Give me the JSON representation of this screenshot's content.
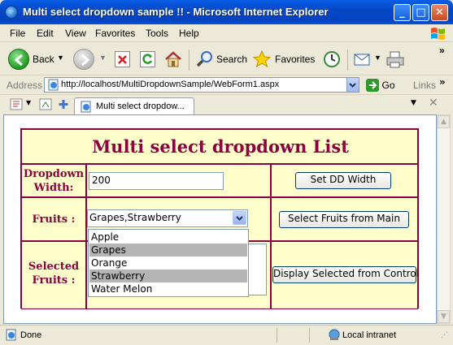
{
  "window": {
    "title": "Multi select dropdown sample !! - Microsoft Internet Explorer",
    "minimize": "_",
    "maximize": "□",
    "close": "✕"
  },
  "menu": [
    "File",
    "Edit",
    "View",
    "Favorites",
    "Tools",
    "Help"
  ],
  "toolbar": {
    "back_label": "Back",
    "search_label": "Search",
    "favorites_label": "Favorites"
  },
  "address": {
    "label": "Address",
    "url": "http://localhost/MultiDropdownSample/WebForm1.aspx",
    "go_label": "Go",
    "links_label": "Links"
  },
  "tab": {
    "title": "Multi select dropdow..."
  },
  "page": {
    "heading": "Multi select dropdown List",
    "dd_width_label": "Dropdown Width:",
    "dd_width_value": "200",
    "set_width_button": "Set DD Width",
    "fruits_label": "Fruits :",
    "fruits_selected_text": "Grapes,Strawberry",
    "select_fruits_button": "Select Fruits from Main",
    "selected_fruits_label": "Selected Fruits :",
    "display_selected_button": "Display Selected from Control",
    "fruit_options": [
      {
        "label": "Apple",
        "selected": false
      },
      {
        "label": "Grapes",
        "selected": true
      },
      {
        "label": "Orange",
        "selected": false
      },
      {
        "label": "Strawberry",
        "selected": true
      },
      {
        "label": "Water Melon",
        "selected": false
      }
    ]
  },
  "status": {
    "text": "Done",
    "zone": "Local intranet"
  },
  "colors": {
    "titlebar": "#0448c8",
    "page_border": "#8b0040",
    "page_background": "#ffffcc",
    "heading_text": "#8b0040",
    "list_selection": "#b4b4b4"
  }
}
